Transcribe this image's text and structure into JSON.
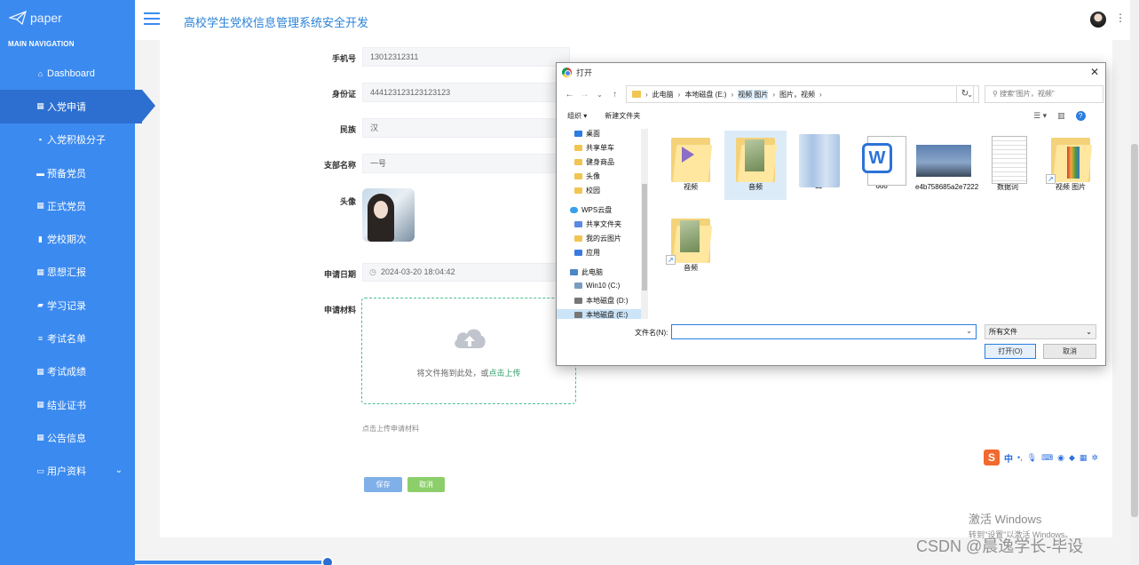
{
  "sidebar": {
    "logo": "paper",
    "nav_heading": "MAIN NAVIGATION",
    "items": [
      {
        "label": "Dashboard",
        "icon": "home-icon"
      },
      {
        "label": "入党申请",
        "icon": "grid-icon",
        "active": true
      },
      {
        "label": "入党积极分子",
        "icon": "comment-icon"
      },
      {
        "label": "预备党员",
        "icon": "card-icon"
      },
      {
        "label": "正式党员",
        "icon": "grid-icon"
      },
      {
        "label": "党校期次",
        "icon": "bar-chart-icon"
      },
      {
        "label": "思想汇报",
        "icon": "grid-icon"
      },
      {
        "label": "学习记录",
        "icon": "lock-icon"
      },
      {
        "label": "考试名单",
        "icon": "list-icon"
      },
      {
        "label": "考试成绩",
        "icon": "grid-icon"
      },
      {
        "label": "结业证书",
        "icon": "grid-icon"
      },
      {
        "label": "公告信息",
        "icon": "grid-icon"
      },
      {
        "label": "用户资料",
        "icon": "calendar-icon"
      }
    ]
  },
  "header": {
    "title": "高校学生党校信息管理系统安全开发"
  },
  "form": {
    "phone_label": "手机号",
    "phone_value": "13012312311",
    "id_label": "身份证",
    "id_value": "444123123123123123",
    "ethnicity_label": "民族",
    "ethnicity_value": "汉",
    "branch_label": "支部名称",
    "branch_value": "一号",
    "avatar_label": "头像",
    "date_label": "申请日期",
    "date_value": "2024-03-20 18:04:42",
    "material_label": "申请材料",
    "upload_text": "将文件拖到此处，或",
    "upload_link": "点击上传",
    "upload_hint": "点击上传申请材料",
    "save_label": "保存",
    "cancel_label": "取消"
  },
  "dialog": {
    "title": "打开",
    "breadcrumb": [
      "此电脑",
      "本地磁盘 (E:)",
      "视频 图片",
      "图片，视频"
    ],
    "search_placeholder": "搜索\"图片，视频\"",
    "organize_label": "组织 ▾",
    "new_folder_label": "新建文件夹",
    "tree": [
      {
        "label": "桌面",
        "icon": "desktop-icon"
      },
      {
        "label": "共享单车",
        "icon": "folder-icon"
      },
      {
        "label": "健身商品",
        "icon": "folder-icon"
      },
      {
        "label": "头像",
        "icon": "folder-icon"
      },
      {
        "label": "校园",
        "icon": "folder-icon"
      },
      {
        "label": "WPS云盘",
        "icon": "cloud-icon"
      },
      {
        "label": "共享文件夹",
        "icon": "share-icon"
      },
      {
        "label": "我的云图片",
        "icon": "folder-icon"
      },
      {
        "label": "应用",
        "icon": "apps-icon"
      },
      {
        "label": "此电脑",
        "icon": "computer-icon"
      },
      {
        "label": "Win10 (C:)",
        "icon": "drive-icon"
      },
      {
        "label": "本地磁盘 (D:)",
        "icon": "drive-icon"
      },
      {
        "label": "本地磁盘 (E:)",
        "icon": "drive-icon"
      }
    ],
    "files": [
      {
        "name": "视频",
        "kind": "video-folder"
      },
      {
        "name": "音频",
        "kind": "image-folder"
      },
      {
        "name": "11",
        "kind": "bottle-image"
      },
      {
        "name": "666",
        "kind": "word-doc"
      },
      {
        "name": "e4b758685a2e7222",
        "kind": "photo"
      },
      {
        "name": "数据词",
        "kind": "text-doc"
      },
      {
        "name": "视频 图片",
        "kind": "zip-shortcut"
      },
      {
        "name": "音频",
        "kind": "folder-shortcut"
      }
    ],
    "filename_label": "文件名(N):",
    "filetype_value": "所有文件",
    "open_label": "打开(O)",
    "cancel_label": "取消"
  },
  "ime": {
    "logo": "S",
    "mode": "中"
  },
  "watermark": {
    "line1": "激活 Windows",
    "line2": "转到\"设置\"以激活 Windows。",
    "csdn": "CSDN @晨逸学长-毕设"
  }
}
